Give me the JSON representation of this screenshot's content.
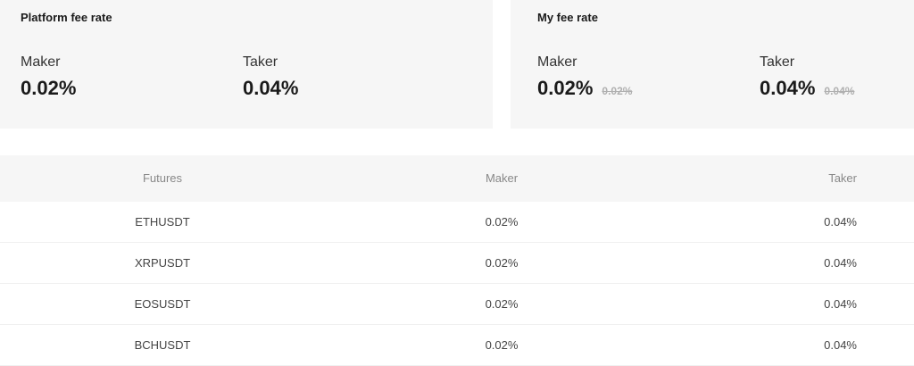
{
  "platform": {
    "title": "Platform fee rate",
    "maker_label": "Maker",
    "maker_value": "0.02%",
    "taker_label": "Taker",
    "taker_value": "0.04%"
  },
  "mine": {
    "title": "My fee rate",
    "maker_label": "Maker",
    "maker_value": "0.02%",
    "maker_old": "0.02%",
    "taker_label": "Taker",
    "taker_value": "0.04%",
    "taker_old": "0.04%"
  },
  "table": {
    "headers": [
      "Futures",
      "Maker",
      "Taker"
    ],
    "rows": [
      [
        "ETHUSDT",
        "0.02%",
        "0.04%"
      ],
      [
        "XRPUSDT",
        "0.02%",
        "0.04%"
      ],
      [
        "EOSUSDT",
        "0.02%",
        "0.04%"
      ],
      [
        "BCHUSDT",
        "0.02%",
        "0.04%"
      ]
    ]
  }
}
